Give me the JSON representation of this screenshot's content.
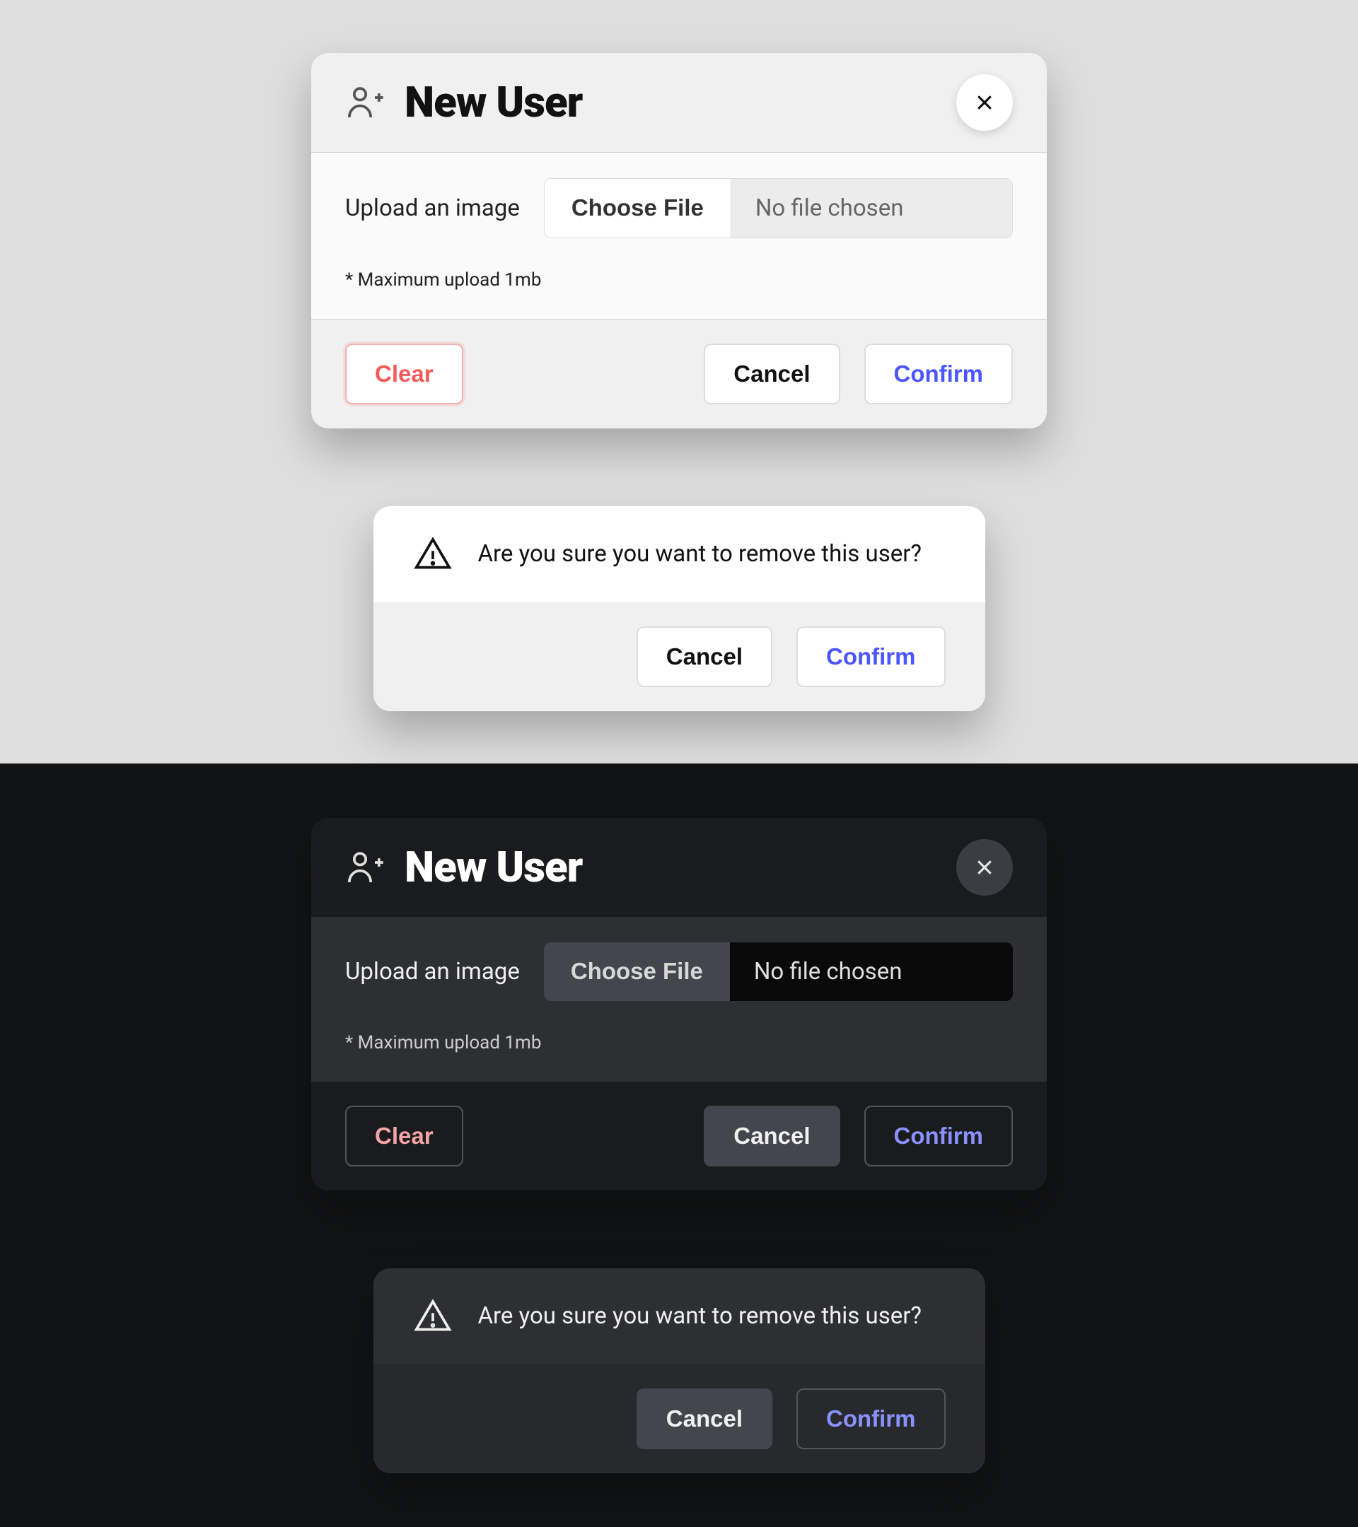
{
  "newUser": {
    "title": "New User",
    "uploadLabel": "Upload an image",
    "chooseFile": "Choose File",
    "fileStatus": "No file chosen",
    "hint": "* Maximum upload 1mb",
    "clear": "Clear",
    "cancel": "Cancel",
    "confirm": "Confirm"
  },
  "removeDialog": {
    "message": "Are you sure you want to remove this user?",
    "cancel": "Cancel",
    "confirm": "Confirm"
  },
  "colors": {
    "lightBg": "#dedede",
    "darkBg": "#121314",
    "danger": "#f55a5a",
    "primary": "#4c56ff",
    "primaryDark": "#8a91ff"
  }
}
